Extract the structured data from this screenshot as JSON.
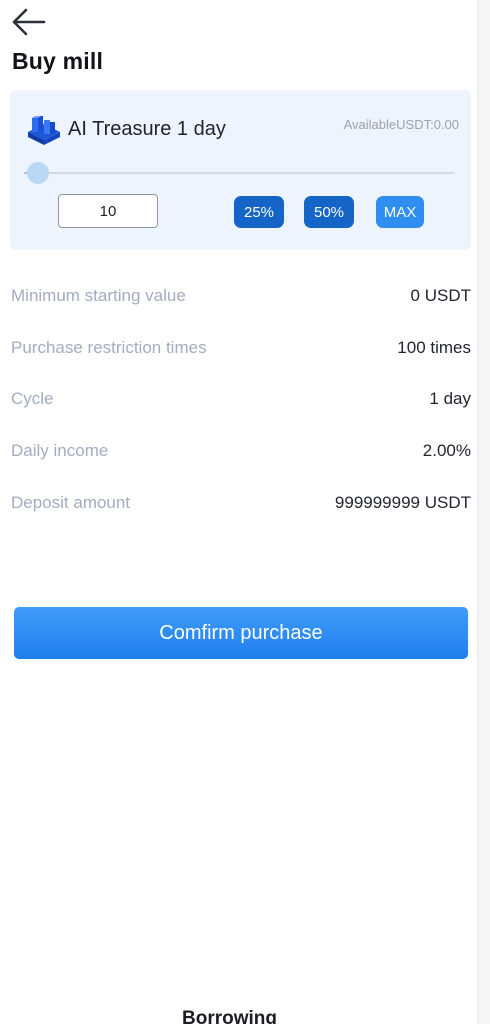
{
  "header": {
    "back_icon": "arrow-left-icon",
    "title": "Buy mill"
  },
  "product": {
    "icon": "mill-cube-icon",
    "name": "AI Treasure 1 day",
    "available": "AvailableUSDT:0.00"
  },
  "amount": {
    "slider_fraction": 0,
    "value": "10"
  },
  "percent_buttons": {
    "p25": "25%",
    "p50": "50%",
    "max": "MAX"
  },
  "details": [
    {
      "label": "Minimum starting value",
      "value": "0 USDT"
    },
    {
      "label": "Purchase restriction times",
      "value": "100 times"
    },
    {
      "label": "Cycle",
      "value": "1 day"
    },
    {
      "label": "Daily income",
      "value": "2.00%"
    },
    {
      "label": "Deposit amount",
      "value": "999999999 USDT"
    }
  ],
  "confirm_label": "Comfirm purchase",
  "bottom_nav": {
    "partial_label": "Borrowing"
  },
  "colors": {
    "accent": "#2e8ff0",
    "accent_dark": "#1565c8",
    "card_bg": "#eef4fd",
    "label_gray": "#a3adbf"
  }
}
